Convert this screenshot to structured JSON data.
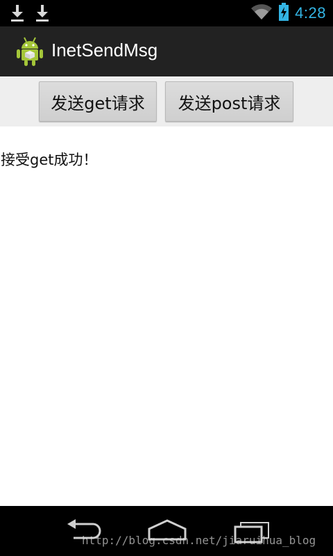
{
  "status_bar": {
    "time": "4:28",
    "icons": [
      "download-icon",
      "download-icon",
      "wifi-icon",
      "battery-charging-icon"
    ],
    "clock_color": "#33b5e5"
  },
  "action_bar": {
    "title": "InetSendMsg",
    "icon": "android-app-icon",
    "background": "#222222"
  },
  "buttons": {
    "get_label": "发送get请求",
    "post_label": "发送post请求"
  },
  "content": {
    "result_text": "接受get成功！"
  },
  "nav_bar": {
    "icons": [
      "back-icon",
      "home-icon",
      "recent-apps-icon"
    ],
    "watermark": "http://blog.csdn.net/jiaruihua_blog"
  }
}
